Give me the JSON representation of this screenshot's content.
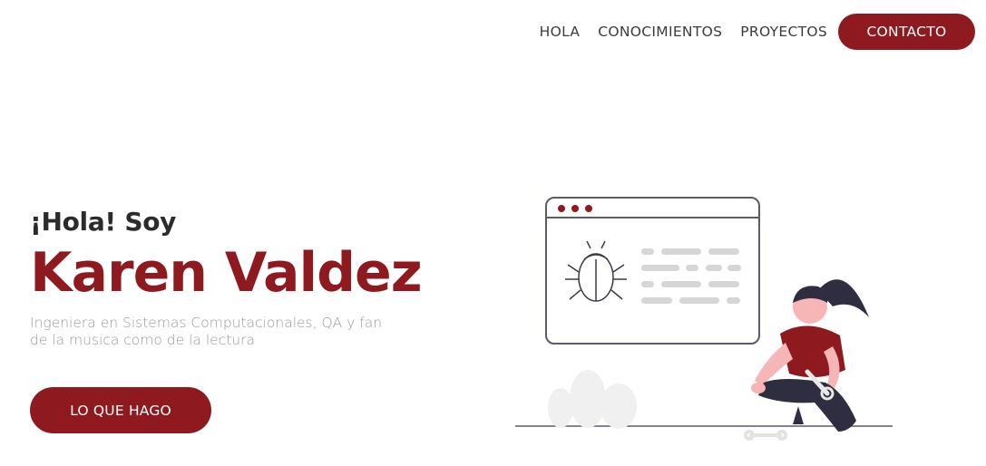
{
  "nav": {
    "links": [
      "HOLA",
      "CONOCIMIENTOS",
      "PROYECTOS"
    ],
    "cta_label": "CONTACTO"
  },
  "hero": {
    "greeting": "¡Hola! Soy",
    "name": "Karen Valdez",
    "tagline_line1": "Ingeniera en Sistemas Computacionales, QA y fan",
    "tagline_line2": "de la musica como de la lectura",
    "cta_label": "LO QUE HAGO"
  },
  "colors": {
    "accent": "#8e1a1f",
    "text_dark": "#2b2b2b",
    "text_muted": "#9b9b9b"
  },
  "illustration": {
    "icons": [
      "browser-window-icon",
      "bug-icon",
      "person-with-wrench-illustration",
      "wrench-icon",
      "plant-icon"
    ]
  }
}
